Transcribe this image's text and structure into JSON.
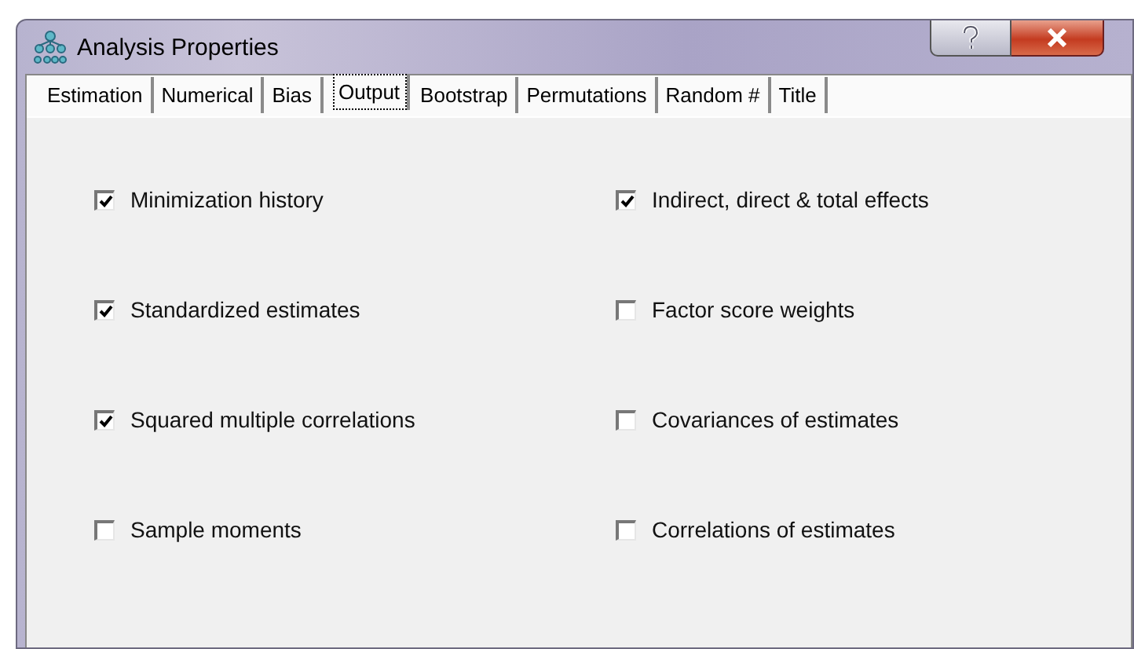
{
  "window": {
    "title": "Analysis Properties"
  },
  "tabs": [
    {
      "label": "Estimation",
      "selected": false
    },
    {
      "label": "Numerical",
      "selected": false
    },
    {
      "label": "Bias",
      "selected": false
    },
    {
      "label": "Output",
      "selected": true
    },
    {
      "label": "Bootstrap",
      "selected": false
    },
    {
      "label": "Permutations",
      "selected": false
    },
    {
      "label": "Random #",
      "selected": false
    },
    {
      "label": "Title",
      "selected": false
    }
  ],
  "columns": [
    {
      "options": [
        {
          "label": "Minimization history",
          "checked": true
        },
        {
          "label": "Standardized estimates",
          "checked": true
        },
        {
          "label": "Squared multiple correlations",
          "checked": true
        },
        {
          "label": "Sample moments",
          "checked": false
        }
      ]
    },
    {
      "options": [
        {
          "label": "Indirect, direct & total effects",
          "checked": true
        },
        {
          "label": "Factor score weights",
          "checked": false
        },
        {
          "label": "Covariances of estimates",
          "checked": false
        },
        {
          "label": "Correlations of estimates",
          "checked": false
        }
      ]
    }
  ]
}
